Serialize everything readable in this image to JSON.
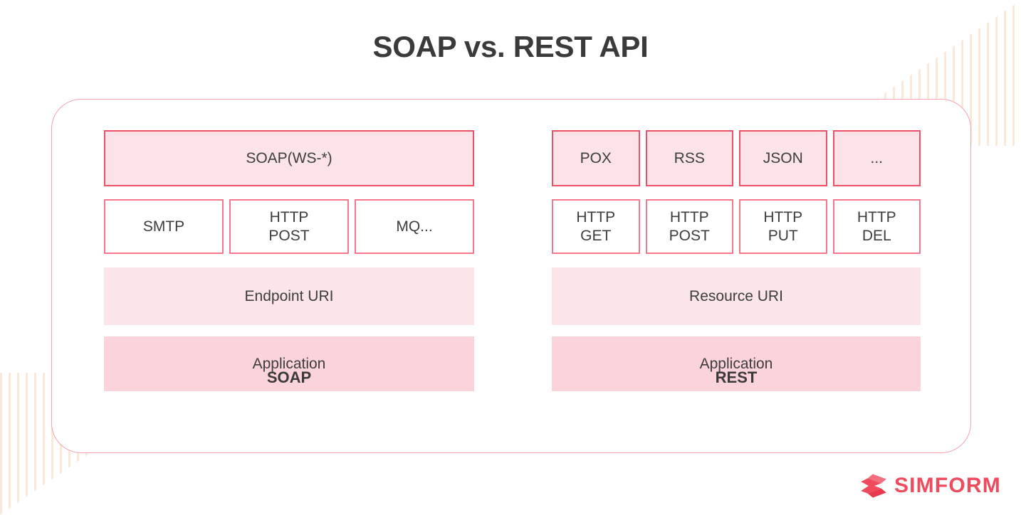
{
  "page": {
    "title": "SOAP vs. REST API",
    "accent_color": "#ee5167",
    "fill_light": "#fce3e8",
    "fill_soft": "#fce5e9",
    "fill_strong": "#fbd3da",
    "text_color": "#3d3d3d",
    "stripe_color": "#f8e9d8"
  },
  "diagram": {
    "columns": [
      {
        "key": "soap",
        "label": "SOAP",
        "rows": [
          {
            "style": "filled-outlined",
            "cells": [
              {
                "text": "SOAP(WS-*)",
                "flex": 1
              }
            ]
          },
          {
            "style": "plain-outlined",
            "cells": [
              {
                "text": "SMTP",
                "flex": 1
              },
              {
                "text": "HTTP\nPOST",
                "flex": 1
              },
              {
                "text": "MQ...",
                "flex": 1
              }
            ]
          },
          {
            "style": "soft-light",
            "cells": [
              {
                "text": "Endpoint URI",
                "flex": 1
              }
            ]
          },
          {
            "style": "soft-strong",
            "cells": [
              {
                "text": "Application",
                "flex": 1
              }
            ]
          }
        ]
      },
      {
        "key": "rest",
        "label": "REST",
        "rows": [
          {
            "style": "filled-outlined",
            "cells": [
              {
                "text": "POX",
                "flex": 1
              },
              {
                "text": "RSS",
                "flex": 1
              },
              {
                "text": "JSON",
                "flex": 1
              },
              {
                "text": "...",
                "flex": 1
              }
            ]
          },
          {
            "style": "plain-outlined",
            "cells": [
              {
                "text": "HTTP\nGET",
                "flex": 1
              },
              {
                "text": "HTTP\nPOST",
                "flex": 1
              },
              {
                "text": "HTTP\nPUT",
                "flex": 1
              },
              {
                "text": "HTTP\nDEL",
                "flex": 1
              }
            ]
          },
          {
            "style": "soft-light",
            "cells": [
              {
                "text": "Resource URI",
                "flex": 1
              }
            ]
          },
          {
            "style": "soft-strong",
            "cells": [
              {
                "text": "Application",
                "flex": 1
              }
            ]
          }
        ]
      }
    ]
  },
  "branding": {
    "logo_icon": "simform-ribbon-icon",
    "wordmark": "SIMFORM",
    "logo_color": "#ee4b5e"
  }
}
